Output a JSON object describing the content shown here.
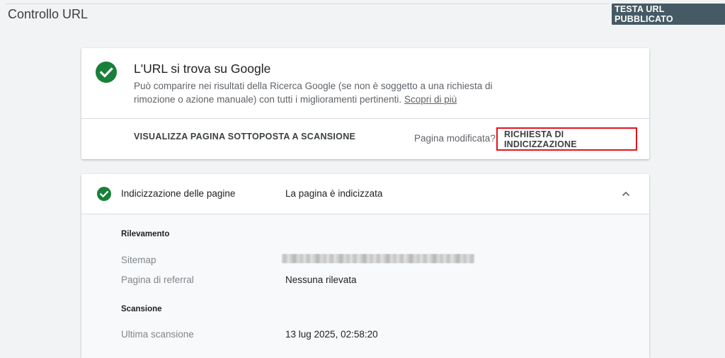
{
  "header": {
    "title": "Controllo URL",
    "test_button_label": "TESTA URL PUBBLICATO"
  },
  "status_card": {
    "icon": "check-circle-icon",
    "title": "L'URL si trova su Google",
    "description": "Può comparire nei risultati della Ricerca Google (se non è soggetto a una richiesta di rimozione o azione manuale) con tutti i miglioramenti pertinenti.",
    "learn_more": "Scopri di più",
    "view_crawled_label": "VISUALIZZA PAGINA SOTTOPOSTA A SCANSIONE",
    "page_modified": "Pagina modificata?",
    "request_indexing_label": "RICHIESTA DI INDICIZZAZIONE"
  },
  "indexing_card": {
    "label": "Indicizzazione delle pagine",
    "value": "La pagina è indicizzata",
    "sections": {
      "discovery_heading": "Rilevamento",
      "sitemap_label": "Sitemap",
      "referral_label": "Pagina di referral",
      "referral_value": "Nessuna rilevata",
      "crawl_heading": "Scansione",
      "last_crawl_label": "Ultima scansione",
      "last_crawl_value": "13 lug 2025, 02:58:20"
    }
  },
  "colors": {
    "success_green": "#188038",
    "highlight_red": "#e3131b",
    "button_dark": "#455a64"
  }
}
